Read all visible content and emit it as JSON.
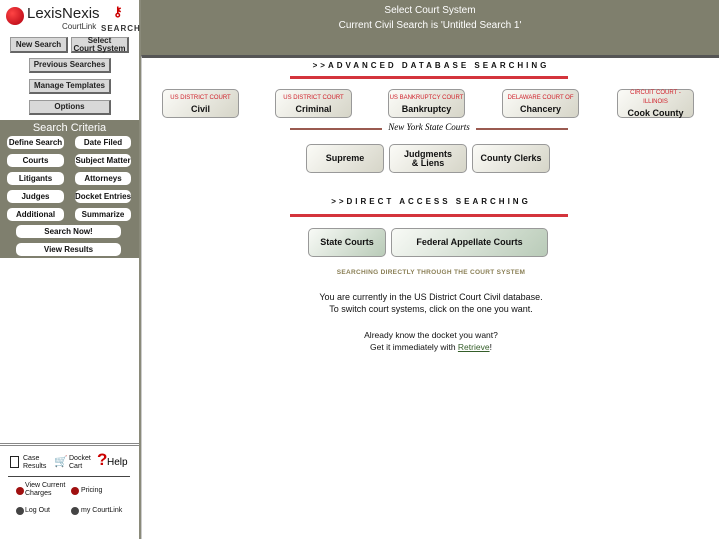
{
  "logo": {
    "brand": "LexisNexis",
    "sub": "CourtLink",
    "search": "SEARCH"
  },
  "sidebar": {
    "new_search": "New Search",
    "select_court_1": "Select",
    "select_court_2": "Court System",
    "previous": "Previous Searches",
    "templates": "Manage Templates",
    "options": "Options",
    "criteria_title": "Search Criteria",
    "criteria": [
      "Define Search",
      "Date Filed",
      "Courts",
      "Subject Matter",
      "Litigants",
      "Attorneys",
      "Judges",
      "Docket Entries",
      "Additional",
      "Summarize"
    ],
    "search_now": "Search Now!",
    "view_results": "View Results",
    "bottom": {
      "case_1": "Case",
      "case_2": "Results",
      "docket_1": "Docket",
      "docket_2": "Cart",
      "help": "Help",
      "charges_1": "View Current",
      "charges_2": "Charges",
      "pricing": "Pricing",
      "logout": "Log Out",
      "mycourtlink": "my CourtLink"
    }
  },
  "header": {
    "title": "Select Court System",
    "subtitle": "Current Civil Search is 'Untitled Search 1'"
  },
  "main": {
    "advanced_title": ">>ADVANCED DATABASE SEARCHING",
    "courts": [
      {
        "small": "US DISTRICT COURT",
        "label": "Civil"
      },
      {
        "small": "US DISTRICT COURT",
        "label": "Criminal"
      },
      {
        "small": "US BANKRUPTCY COURT",
        "label": "Bankruptcy"
      },
      {
        "small": "DELAWARE COURT OF",
        "label": "Chancery"
      },
      {
        "small": "CIRCUIT COURT - ILLINOIS",
        "label": "Cook County"
      }
    ],
    "ny_title": "New York State Courts",
    "ny": [
      "Supreme",
      "Judgments",
      "& Liens",
      "County Clerks"
    ],
    "direct_title": ">>DIRECT ACCESS SEARCHING",
    "direct": [
      "State Courts",
      "Federal Appellate Courts"
    ],
    "direct_sub": "SEARCHING DIRECTLY THROUGH THE COURT SYSTEM",
    "info_1": "You are currently in the US District Court Civil database.",
    "info_2": "To switch court systems, click on the one you want.",
    "know_1": "Already know the docket you want?",
    "know_2": "Get it immediately with ",
    "retrieve": "Retrieve",
    "excl": "!"
  },
  "colors": {
    "header": "#7f7f6d",
    "accent_red": "#d4343c"
  }
}
